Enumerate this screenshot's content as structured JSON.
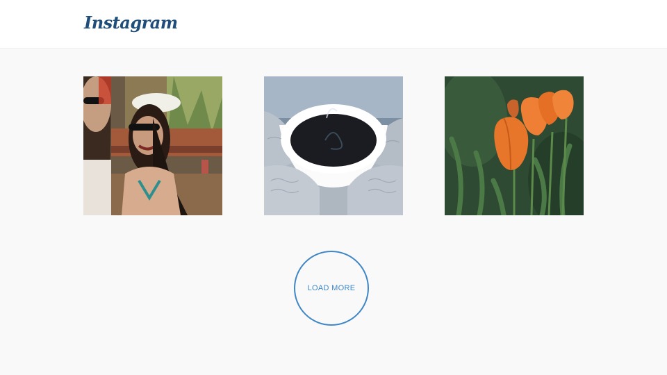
{
  "header": {
    "logo_text": "Instagram"
  },
  "photos": [
    {
      "subject": "two women laughing outdoors"
    },
    {
      "subject": "cup of coffee held in knitted mittens"
    },
    {
      "subject": "orange tulips"
    }
  ],
  "load_more": {
    "label": "LOAD MORE"
  },
  "colors": {
    "accent": "#3f86c6",
    "logo": "#1f4e7a",
    "background": "#f9f9f9",
    "header": "#ffffff"
  }
}
